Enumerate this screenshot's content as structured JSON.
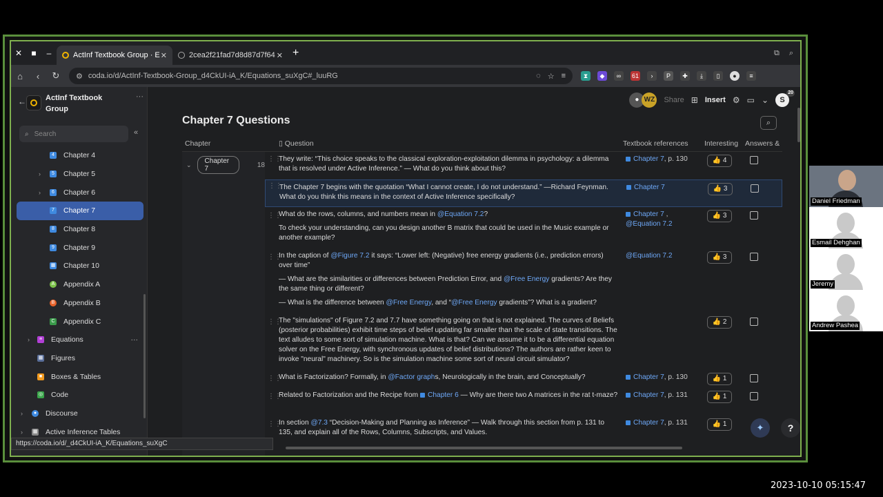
{
  "browser": {
    "tabs": [
      {
        "label": "ActInf Textbook Group · E"
      },
      {
        "label": "2cea2f21fad7d8d87d7f64"
      }
    ],
    "url": "coda.io/d/ActInf-Textbook-Group_d4CkUI-iA_K/Equations_suXgC#_luuRG",
    "status_url": "https://coda.io/d/_d4CkUI-iA_K/Equations_suXgC",
    "ext_badge": "61"
  },
  "sidebar": {
    "doc_title": "ActInf Textbook Group",
    "search_placeholder": "Search",
    "items": [
      {
        "label": "Chapter 4",
        "icon": "4",
        "color": "#3f8ae0"
      },
      {
        "label": "Chapter 5",
        "icon": "5",
        "color": "#3f8ae0"
      },
      {
        "label": "Chapter 6",
        "icon": "6",
        "color": "#3f8ae0"
      },
      {
        "label": "Chapter 7",
        "icon": "7",
        "color": "#3f8ae0"
      },
      {
        "label": "Chapter 8",
        "icon": "8",
        "color": "#3f8ae0"
      },
      {
        "label": "Chapter 9",
        "icon": "9",
        "color": "#3f8ae0"
      },
      {
        "label": "Chapter 10",
        "icon": "10",
        "color": "#3f8ae0"
      },
      {
        "label": "Appendix A",
        "icon": "A",
        "color": "#7cc24a"
      },
      {
        "label": "Appendix B",
        "icon": "B",
        "color": "#e8632b"
      },
      {
        "label": "Appendix C",
        "icon": "C",
        "color": "#3a9a4a"
      },
      {
        "label": "Equations",
        "icon": "eq",
        "color": "#b23fd6"
      },
      {
        "label": "Figures",
        "icon": "fig",
        "color": "#5a6f9a"
      },
      {
        "label": "Boxes & Tables",
        "icon": "box",
        "color": "#f29a1f"
      },
      {
        "label": "Code",
        "icon": "code",
        "color": "#3aa54a"
      },
      {
        "label": "Discourse",
        "icon": "disc",
        "color": "#3f8ae0"
      },
      {
        "label": "Active Inference Tables",
        "icon": "tbl",
        "color": "#888"
      }
    ]
  },
  "topbar": {
    "avatar_initials": "WZ",
    "share_label": "Share",
    "insert_label": "Insert",
    "account_initial": "S",
    "account_badge": "20"
  },
  "page": {
    "title": "Chapter 7 Questions"
  },
  "table": {
    "headers": {
      "chapter": "Chapter",
      "question": "Question",
      "refs": "Textbook references",
      "interesting": "Interesting",
      "answers": "Answers &"
    },
    "group": {
      "label": "Chapter 7",
      "count": "18"
    },
    "rows": [
      {
        "q1": "They write: “This choice speaks to the classical exploration-exploitation dilemma in psychology: a dilemma that is resolved under Active Inference.” — What do you think about this?",
        "ref_link": "Chapter 7",
        "ref_page": ", p. 130",
        "likes": "4"
      },
      {
        "q1": "The Chapter 7 begins with the quotation “What I cannot create, I do not understand.” —Richard Feynman. What do you think this means in the context of Active Inference specifically?",
        "ref_link": "Chapter 7",
        "likes": "3"
      },
      {
        "q_pre": "What do the rows, columns, and numbers mean in ",
        "q_link": "@Equation 7.2",
        "q_post": "?",
        "q2": "To check your understanding, can you design another B matrix that could be used in the Music example or another example?",
        "ref_link": "Chapter 7",
        "ref_page": " ,",
        "ref_link2": "@Equation 7.2",
        "likes": "3"
      },
      {
        "q_pre": "In the caption of ",
        "q_link": "@Figure 7.2",
        "q_post": "  it says: “Lower left: (Negative) free energy gradients (i.e., prediction errors) over time”",
        "q2_pre": "— What are the similarities or differences between Prediction Error, and ",
        "q2_link": "@Free Energy",
        "q2_post": " gradients? Are they the same thing or different?",
        "q3_pre": "— What is the difference between ",
        "q3_link": "@Free Energy",
        "q3_mid": ", and “",
        "q3_link2": "@Free Energy",
        "q3_post": " gradients”? What is a gradient?",
        "ref_link": "@Equation 7.2",
        "likes": "3"
      },
      {
        "q1": "The \"simulations\" of Figure 7.2 and 7.7 have something going on that is not explained.  The curves of Beliefs (posterior probabilities) exhibit time steps of belief updating far smaller than the scale of state transitions.  The text alludes to some sort of simulation machine.  What is that?  Can we assume it to be a differential equation solver on the Free Energy, with synchronous updates of belief distributions?  The authors are rather keen to invoke \"neural\" machinery.  So is the simulation machine some sort of neural circuit simulator?",
        "likes": "2"
      },
      {
        "q_pre": "What is Factorization? Formally, in ",
        "q_link": "@Factor graph",
        "q_post": "s, Neurologically in the brain, and Conceptually?",
        "ref_link": "Chapter 7",
        "ref_page": ", p. 130",
        "likes": "1"
      },
      {
        "q_pre": "Related to Factorization and the Recipe from ",
        "q_link": "Chapter 6",
        "q_post": "  — Why are there two A matrices in the rat t-maze?",
        "ref_link": "Chapter 7",
        "ref_page": ", p. 131",
        "likes": "1"
      },
      {
        "q_pre": "In section ",
        "q_link": "@7.3",
        "q_post": " “Decision-Making and Planning as Inference” — Walk through this section from p. 131 to 135, and explain all of the Rows, Columns, Subscripts, and Values.",
        "ref_link": "Chapter 7",
        "ref_page": ", p. 131",
        "likes": "1"
      }
    ]
  },
  "participants": [
    {
      "name": "Daniel Friedman",
      "camera": true
    },
    {
      "name": "Esmail Dehghan",
      "camera": false
    },
    {
      "name": "Jeremy",
      "camera": false
    },
    {
      "name": "Andrew Pashea",
      "camera": false
    }
  ],
  "timestamp": "2023-10-10 05:15:47"
}
